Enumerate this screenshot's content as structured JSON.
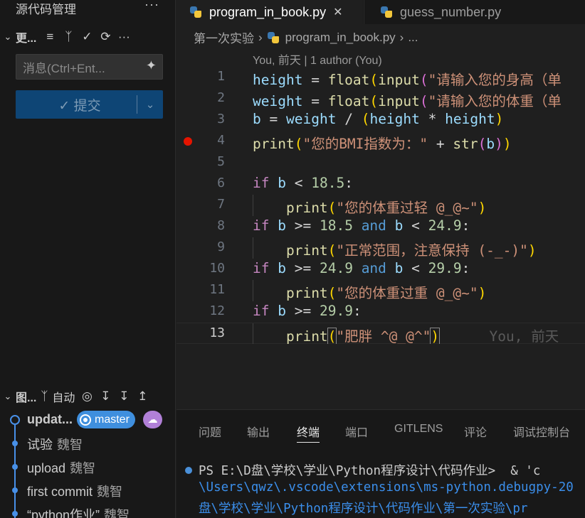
{
  "sidebar": {
    "title": "源代码管理",
    "more": "···",
    "changes_label": "更...",
    "message_placeholder": "消息(Ctrl+Ent...",
    "commit_label": "✓ 提交",
    "graph_label": "图...",
    "graph_auto": "自动",
    "commits": [
      {
        "message": "updat...",
        "author": ""
      },
      {
        "message": "试验",
        "author": "魏智"
      },
      {
        "message": "upload",
        "author": "魏智"
      },
      {
        "message": "first commit",
        "author": "魏智"
      },
      {
        "message": "“python作业”",
        "author": "魏智"
      }
    ],
    "branch_badge": "master"
  },
  "tabs": [
    {
      "label": "program_in_book.py",
      "active": true
    },
    {
      "label": "guess_number.py",
      "active": false
    }
  ],
  "breadcrumb": {
    "folder": "第一次实验",
    "file": "program_in_book.py",
    "tail": "..."
  },
  "codelens": "You, 前天 | 1 author (You)",
  "editor": {
    "line_numbers": [
      "1",
      "2",
      "3",
      "4",
      "5",
      "6",
      "7",
      "8",
      "9",
      "10",
      "11",
      "12",
      "13"
    ],
    "current_line": "13",
    "breakpoint_line": "4",
    "strings": {
      "s1": "\"请输入您的身高（单",
      "s2": "\"请输入您的体重（单",
      "s4": "\"您的BMI指数为：\"",
      "s7": "\"您的体重过轻 @_@~\"",
      "s9": "\"正常范围，注意保持 (-_-)\"",
      "s11": "\"您的体重过重 @_@~\"",
      "s13": "\"肥胖 ^@_@^\""
    },
    "blame": "You, 前天"
  },
  "panel": {
    "tabs": [
      "问题",
      "输出",
      "终端",
      "端口",
      "GITLENS",
      "评论",
      "调试控制台"
    ],
    "active_tab": "终端",
    "terminal_lines": [
      "PS E:\\D盘\\学校\\学业\\Python程序设计\\代码作业>  & 'c",
      "\\Users\\qwz\\.vscode\\extensions\\ms-python.debugpy-20",
      "盘\\学校\\学业\\Python程序设计\\代码作业\\第一次实验\\pr"
    ]
  },
  "colors": {
    "accent": "#0e4575",
    "branch": "#3f8fde",
    "cloud": "#b180d7",
    "breakpoint": "#e51400"
  }
}
